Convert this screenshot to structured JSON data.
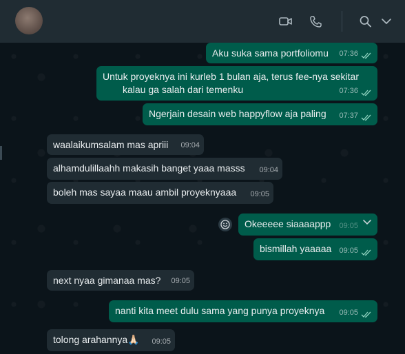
{
  "header": {
    "top_fragment": "",
    "contact_name": "",
    "icons": [
      "video-call-icon",
      "voice-call-icon",
      "search-icon",
      "menu-chevron-icon"
    ]
  },
  "messages": [
    {
      "dir": "out",
      "text": "Aku suka sama portfoliomu",
      "time": "07:36",
      "status": "read"
    },
    {
      "dir": "out",
      "text": "Untuk proyeknya ini kurleb 1 bulan aja, terus fee-nya sekitar\nkalau ga salah dari temenku",
      "time": "07:36",
      "status": "read"
    },
    {
      "dir": "out",
      "text": "Ngerjain desain web happyflow aja paling",
      "time": "07:37",
      "status": "read"
    },
    {
      "dir": "in",
      "text": "waalaikumsalam mas apriii",
      "time": "09:04"
    },
    {
      "dir": "in",
      "text": "alhamdulillaahh makasih banget yaaa masss",
      "time": "09:04"
    },
    {
      "dir": "in",
      "text": "boleh mas sayaa maau ambil proyeknyaaa",
      "time": "09:05"
    },
    {
      "dir": "out",
      "text": "Okeeeee siaaaappp",
      "time": "09:05",
      "status": "read"
    },
    {
      "dir": "out",
      "text": "bismillah yaaaaa",
      "time": "09:05",
      "status": "read"
    },
    {
      "dir": "in",
      "text": "next nyaa gimanaa mas?",
      "time": "09:05"
    },
    {
      "dir": "out",
      "text": "nanti kita meet dulu sama yang punya proyeknya",
      "time": "09:05",
      "status": "read"
    },
    {
      "dir": "in",
      "text": "tolong arahannya🙏🏻",
      "time": "09:05"
    }
  ],
  "colors": {
    "outgoing": "#005c4b",
    "incoming": "#202c33",
    "header": "#202c33",
    "tick_read": "#8fd3c0"
  }
}
